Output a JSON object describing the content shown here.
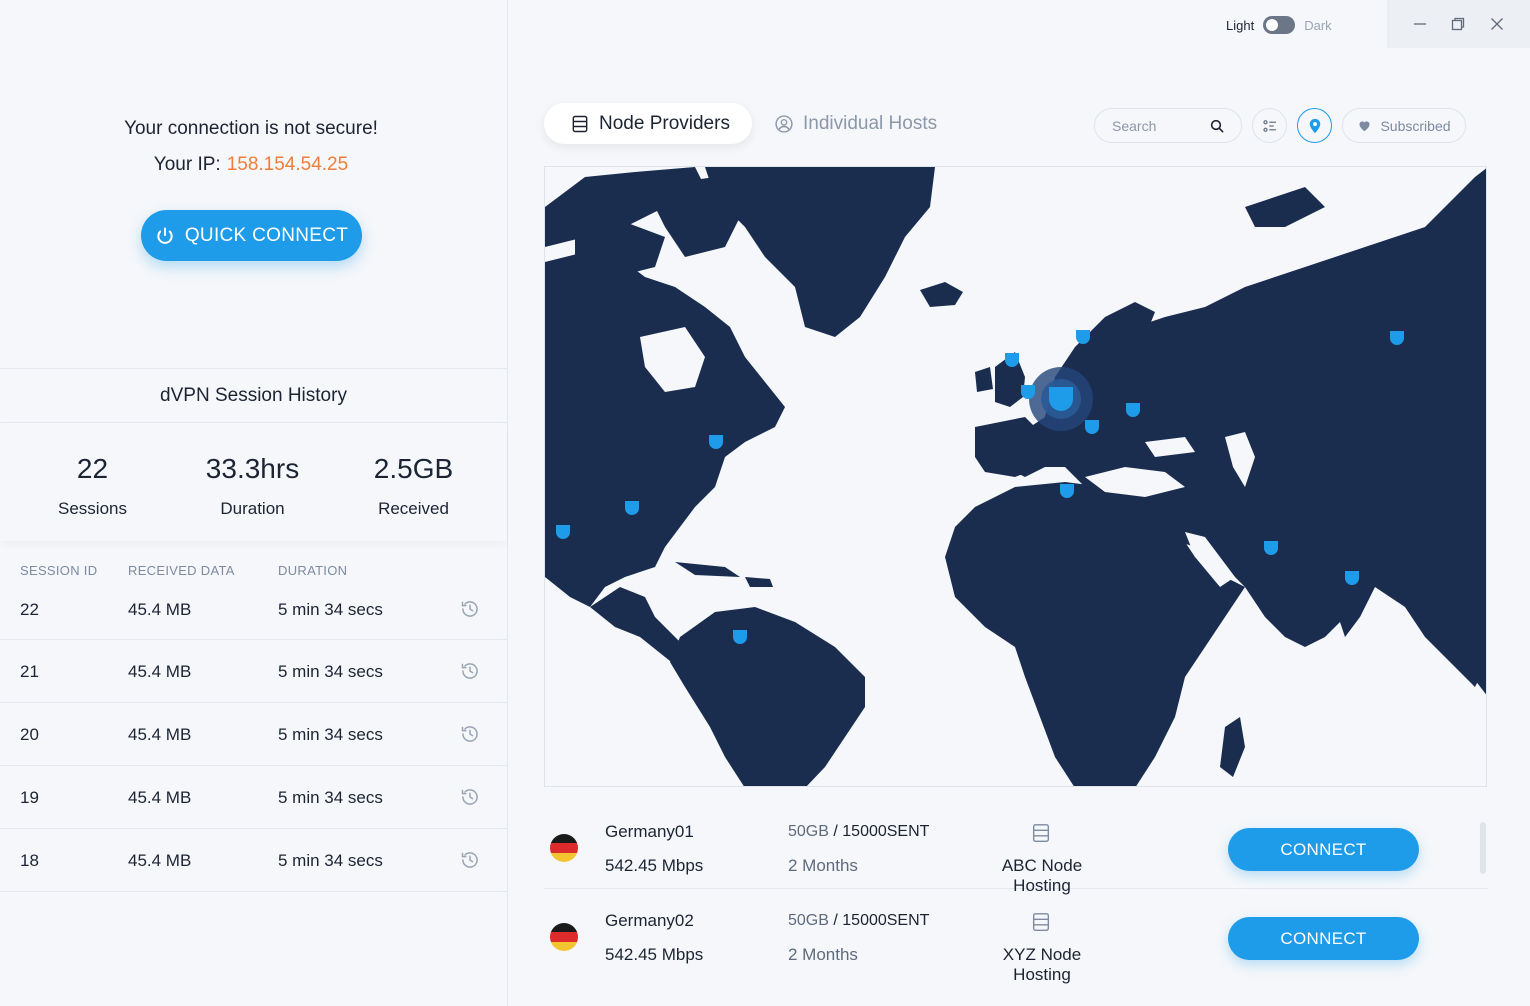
{
  "connection": {
    "warning": "Your connection is not secure!",
    "ip_label": "Your IP:",
    "ip_value": "158.154.54.25",
    "quick_connect": "QUICK CONNECT"
  },
  "history": {
    "title": "dVPN Session History",
    "stats": [
      {
        "value": "22",
        "label": "Sessions"
      },
      {
        "value": "33.3hrs",
        "label": "Duration"
      },
      {
        "value": "2.5GB",
        "label": "Received"
      }
    ],
    "columns": [
      "SESSION ID",
      "RECEIVED DATA",
      "DURATION"
    ],
    "rows": [
      {
        "id": "22",
        "data": "45.4 MB",
        "duration": "5 min 34 secs"
      },
      {
        "id": "21",
        "data": "45.4 MB",
        "duration": "5 min 34 secs"
      },
      {
        "id": "20",
        "data": "45.4 MB",
        "duration": "5 min 34 secs"
      },
      {
        "id": "19",
        "data": "45.4 MB",
        "duration": "5 min 34 secs"
      },
      {
        "id": "18",
        "data": "45.4 MB",
        "duration": "5 min 34 secs"
      }
    ]
  },
  "theme": {
    "light": "Light",
    "dark": "Dark"
  },
  "tabs": {
    "node_providers": "Node Providers",
    "individual_hosts": "Individual Hosts"
  },
  "toolbar": {
    "search_placeholder": "Search",
    "subscribed": "Subscribed"
  },
  "colors": {
    "accent": "#1e9be9",
    "ip": "#f07d3a",
    "map_land": "#1a2d4f",
    "pin": "#1e9be9"
  },
  "nodes": [
    {
      "name": "Germany01",
      "speed": "542.45 Mbps",
      "gb": "50GB",
      "sent": "15000SENT",
      "duration": "2 Months",
      "host": "ABC Node Hosting",
      "button": "CONNECT"
    },
    {
      "name": "Germany02",
      "speed": "542.45 Mbps",
      "gb": "50GB",
      "sent": "15000SENT",
      "duration": "2 Months",
      "host": "XYZ Node Hosting",
      "button": "CONNECT"
    }
  ]
}
